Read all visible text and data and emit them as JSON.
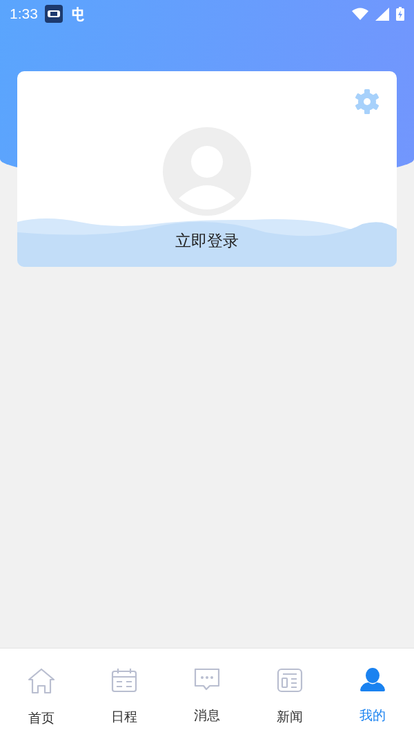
{
  "status_bar": {
    "time": "1:33"
  },
  "profile_card": {
    "login_label": "立即登录"
  },
  "bottom_nav": [
    {
      "kind": "home",
      "label": "首页",
      "selected": false
    },
    {
      "kind": "calendar",
      "label": "日程",
      "selected": false
    },
    {
      "kind": "message",
      "label": "消息",
      "selected": false
    },
    {
      "kind": "news",
      "label": "新闻",
      "selected": false
    },
    {
      "kind": "person",
      "label": "我的",
      "selected": true
    }
  ]
}
